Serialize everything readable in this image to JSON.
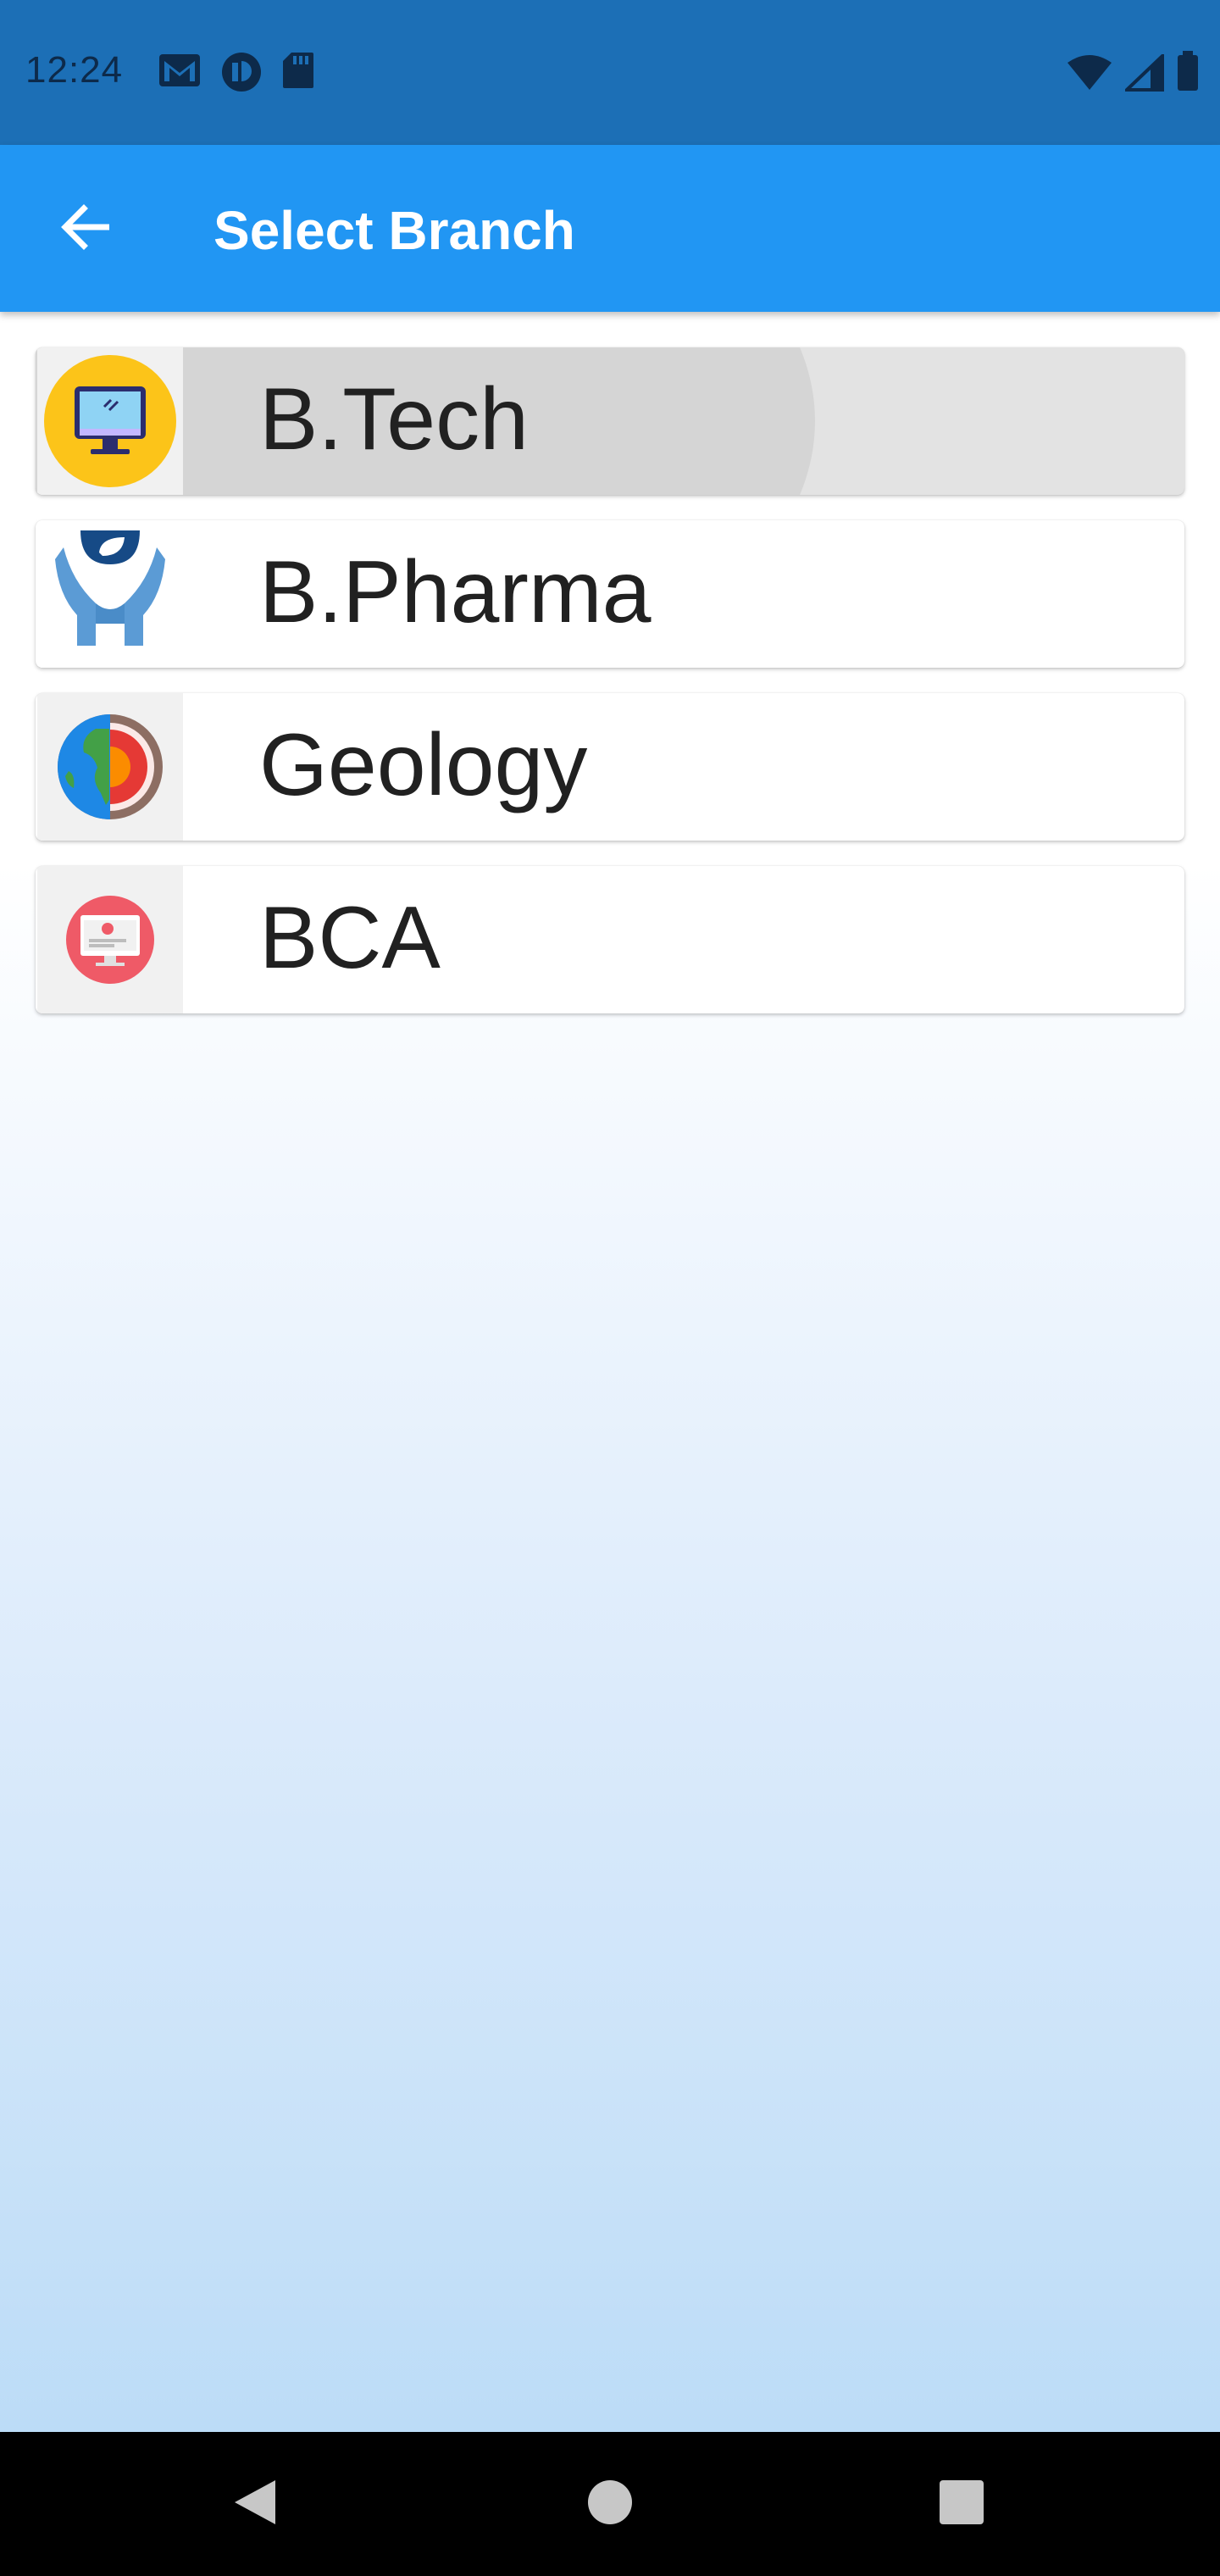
{
  "status_bar": {
    "time": "12:24",
    "left_icons": [
      "gmail-icon",
      "app-notification-icon",
      "sd-card-icon"
    ],
    "right_icons": [
      "wifi-icon",
      "signal-icon",
      "battery-icon"
    ]
  },
  "app_bar": {
    "title": "Select Branch",
    "back_icon": "arrow-back-icon",
    "background": "#2196f3"
  },
  "branches": [
    {
      "label": "B.Tech",
      "icon": "computer-monitor-icon",
      "selected": true
    },
    {
      "label": "B.Pharma",
      "icon": "hands-leaf-icon",
      "selected": false
    },
    {
      "label": " Geology",
      "icon": "earth-layers-icon",
      "selected": false
    },
    {
      "label": "BCA",
      "icon": "computer-screen-icon",
      "selected": false
    }
  ],
  "nav_bar": {
    "buttons": [
      "back-triangle-icon",
      "home-circle-icon",
      "recents-square-icon"
    ]
  }
}
